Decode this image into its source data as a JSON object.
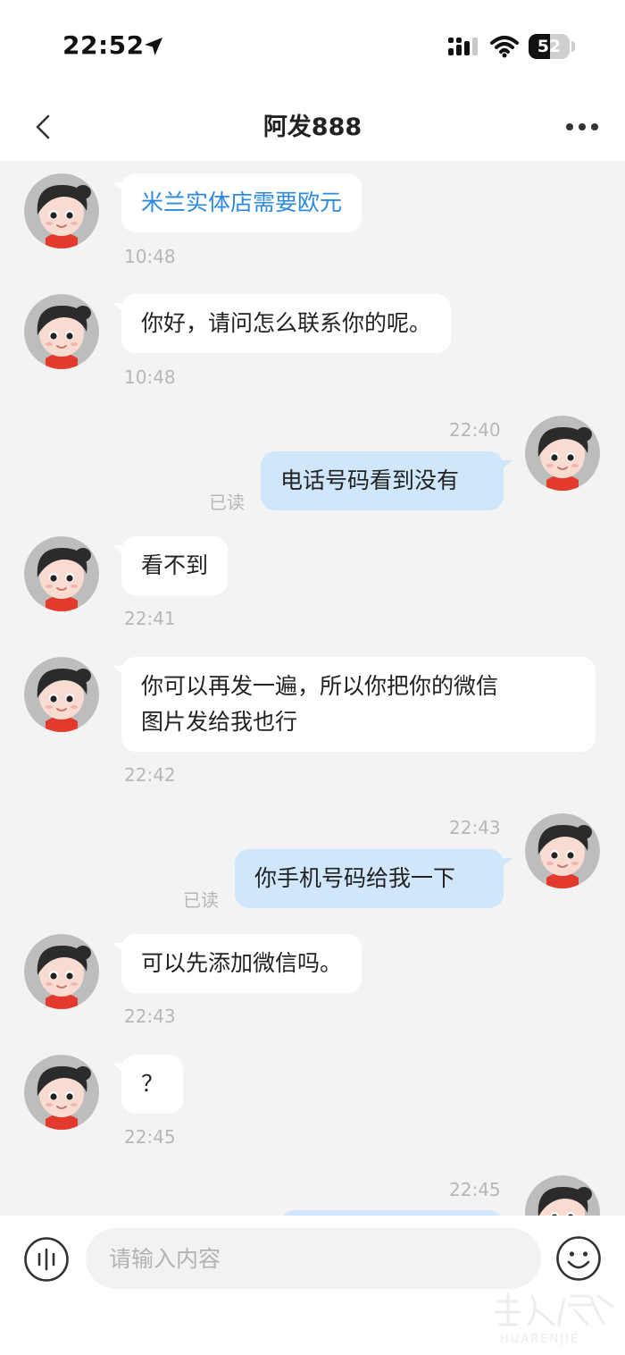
{
  "status_bar": {
    "time": "22:52",
    "battery": "52",
    "battery_level": 0.52
  },
  "header": {
    "title": "阿发888"
  },
  "messages": [
    {
      "dir": "in",
      "text": "米兰实体店需要欧元",
      "time": "10:48",
      "link": true
    },
    {
      "dir": "in",
      "text": "你好，请问怎么联系你的呢。",
      "time": "10:48"
    },
    {
      "dir": "out",
      "text": "电话号码看到没有",
      "time": "22:40",
      "read": "已读"
    },
    {
      "dir": "in",
      "text": "看不到",
      "time": "22:41"
    },
    {
      "dir": "in",
      "lines": [
        "你可以再发一遍，所以你把你的微信",
        "图片发给我也行"
      ],
      "time": "22:42"
    },
    {
      "dir": "out",
      "text": "你手机号码给我一下",
      "time": "22:43",
      "read": "已读"
    },
    {
      "dir": "in",
      "text": "可以先添加微信吗。",
      "time": "22:43"
    },
    {
      "dir": "in",
      "text": "？",
      "time": "22:45"
    },
    {
      "dir": "out",
      "text": "",
      "time": "22:45"
    }
  ],
  "input": {
    "placeholder": "请输入内容"
  },
  "colors": {
    "accent_link": "#2c8ae0",
    "outgoing_bubble": "#cfe6fb",
    "chat_background": "#f3f3f3"
  },
  "watermark": {
    "text": "华人街",
    "subtext": "HUARENJIE"
  }
}
